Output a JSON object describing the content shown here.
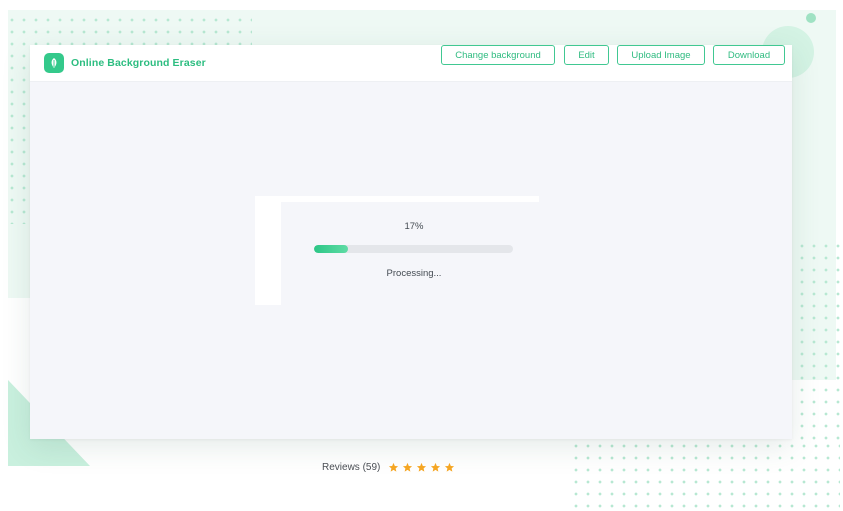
{
  "app": {
    "title": "Online Background Eraser",
    "accent_color": "#34c98b"
  },
  "header": {
    "logo_icon": "leaf-logo-icon",
    "buttons": [
      {
        "id": "change-background",
        "label": "Change background"
      },
      {
        "id": "edit",
        "label": "Edit"
      },
      {
        "id": "upload-image",
        "label": "Upload Image"
      },
      {
        "id": "download",
        "label": "Download"
      }
    ]
  },
  "processing": {
    "percent_text": "17%",
    "progress": 0.17,
    "status": "Processing..."
  },
  "reviews": {
    "label": "Reviews (59)",
    "rating": 5,
    "max_rating": 5,
    "star_color": "#f5a623"
  }
}
